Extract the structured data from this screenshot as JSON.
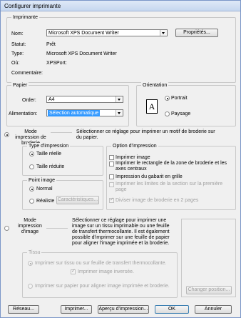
{
  "title": "Configurer imprimante",
  "printer": {
    "legend": "Imprimante",
    "name_label": "Nom:",
    "name_value": "Microsoft XPS Document Writer",
    "properties_button": "Propriétés...",
    "status_label": "Statut:",
    "status_value": "Prêt",
    "type_label": "Type:",
    "type_value": "Microsoft XPS Document Writer",
    "where_label": "Où:",
    "where_value": "XPSPort:",
    "comment_label": "Commentaire:"
  },
  "paper": {
    "legend": "Papier",
    "order_label": "Order:",
    "order_value": "A4",
    "feed_label": "Alimentation:",
    "feed_value": "Sélection automatique"
  },
  "orientation": {
    "legend": "Orientation",
    "portrait": "Portrait",
    "landscape": "Paysage",
    "icon_letter": "A"
  },
  "embroidery_mode": {
    "label": "Mode impression de broderie",
    "description": "Sélectionner ce réglage pour imprimer un motif de broderie sur du papier.",
    "print_type": {
      "legend": "Type d'impression",
      "actual": "Taille réelle",
      "reduced": "Taille réduite"
    },
    "point_image": {
      "legend": "Point image",
      "normal": "Normal",
      "realistic": "Réaliste",
      "characteristics_button": "Caractéristiques..."
    },
    "print_options": {
      "legend": "Option d'impression",
      "items": [
        "Imprimer image",
        "Imprimer le rectangle de la zone de broderie et les axes centraux",
        "Impression du gabarit en grille",
        "Imprimer les limites de la section sur la première page",
        "Diviser image de broderie en 2 pages"
      ]
    }
  },
  "image_mode": {
    "label": "Mode impression d'image",
    "description": "Sélectionner ce réglage pour imprimer une image sur un tissu imprimable ou une feuille de transfert thermocollante. Il est également possible d'imprimer sur une feuille de papier pour aligner l'image imprimée et la broderie.",
    "fabric": {
      "legend": "Tissu",
      "option1": "Imprimer sur tissu ou sur feuille de transfert thermocollante.",
      "inverted": "Imprimer image inversée.",
      "option2": "Imprimer sur papier pour aligner image imprimée et broderie."
    },
    "change_position_button": "Changer position..."
  },
  "footer": {
    "network": "Réseau...",
    "print": "Imprimer...",
    "preview": "Aperçu d'impression...",
    "ok": "OK",
    "cancel": "Annuler"
  },
  "colors": {
    "accent": "#3399ff",
    "title_bar": "#c6d7ef"
  }
}
